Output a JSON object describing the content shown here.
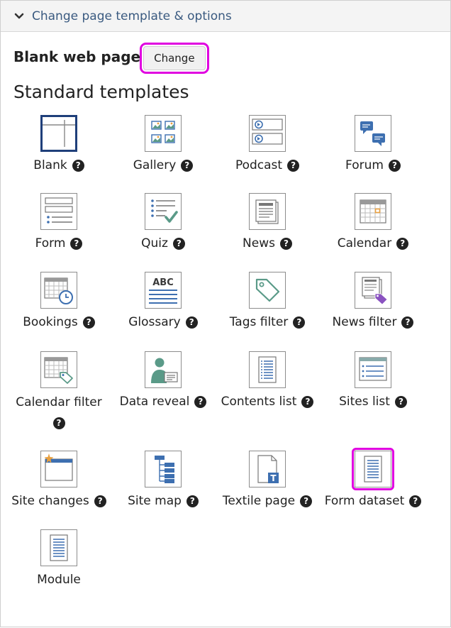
{
  "header": {
    "title": "Change page template & options"
  },
  "current": {
    "label": "Blank web page",
    "change_label": "Change"
  },
  "section": {
    "title": "Standard templates"
  },
  "templates": [
    {
      "name": "Blank",
      "icon": "blank-template-icon",
      "help": "?"
    },
    {
      "name": "Gallery",
      "icon": "gallery-template-icon",
      "help": "?"
    },
    {
      "name": "Podcast",
      "icon": "podcast-template-icon",
      "help": "?"
    },
    {
      "name": "Forum",
      "icon": "forum-template-icon",
      "help": "?"
    },
    {
      "name": "Form",
      "icon": "form-template-icon",
      "help": "?"
    },
    {
      "name": "Quiz",
      "icon": "quiz-template-icon",
      "help": "?"
    },
    {
      "name": "News",
      "icon": "news-template-icon",
      "help": "?"
    },
    {
      "name": "Calendar",
      "icon": "calendar-template-icon",
      "help": "?"
    },
    {
      "name": "Bookings",
      "icon": "bookings-template-icon",
      "help": "?"
    },
    {
      "name": "Glossary",
      "icon": "glossary-template-icon",
      "help": "?",
      "glyph": "ABC"
    },
    {
      "name": "Tags filter",
      "icon": "tags-filter-template-icon",
      "help": "?"
    },
    {
      "name": "News filter",
      "icon": "news-filter-template-icon",
      "help": "?"
    },
    {
      "name": "Calendar filter",
      "icon": "calendar-filter-template-icon",
      "help": "?"
    },
    {
      "name": "Data reveal",
      "icon": "data-reveal-template-icon",
      "help": "?"
    },
    {
      "name": "Contents list",
      "icon": "contents-list-template-icon",
      "help": "?"
    },
    {
      "name": "Sites list",
      "icon": "sites-list-template-icon",
      "help": "?"
    },
    {
      "name": "Site changes",
      "icon": "site-changes-template-icon",
      "help": "?"
    },
    {
      "name": "Site map",
      "icon": "site-map-template-icon",
      "help": "?"
    },
    {
      "name": "Textile page",
      "icon": "textile-page-template-icon",
      "help": "?",
      "glyph": "T"
    },
    {
      "name": "Form dataset",
      "icon": "form-dataset-template-icon",
      "help": "?"
    },
    {
      "name": "Module",
      "icon": "module-template-icon",
      "help": ""
    }
  ],
  "colors": {
    "accent": "#3a5a80",
    "highlight": "#e000e0",
    "selected": "#1f3f7a",
    "icon_blue": "#3d6fb0",
    "icon_green": "#5a9a88",
    "icon_orange": "#e8a040",
    "icon_purple": "#8a52c0"
  }
}
